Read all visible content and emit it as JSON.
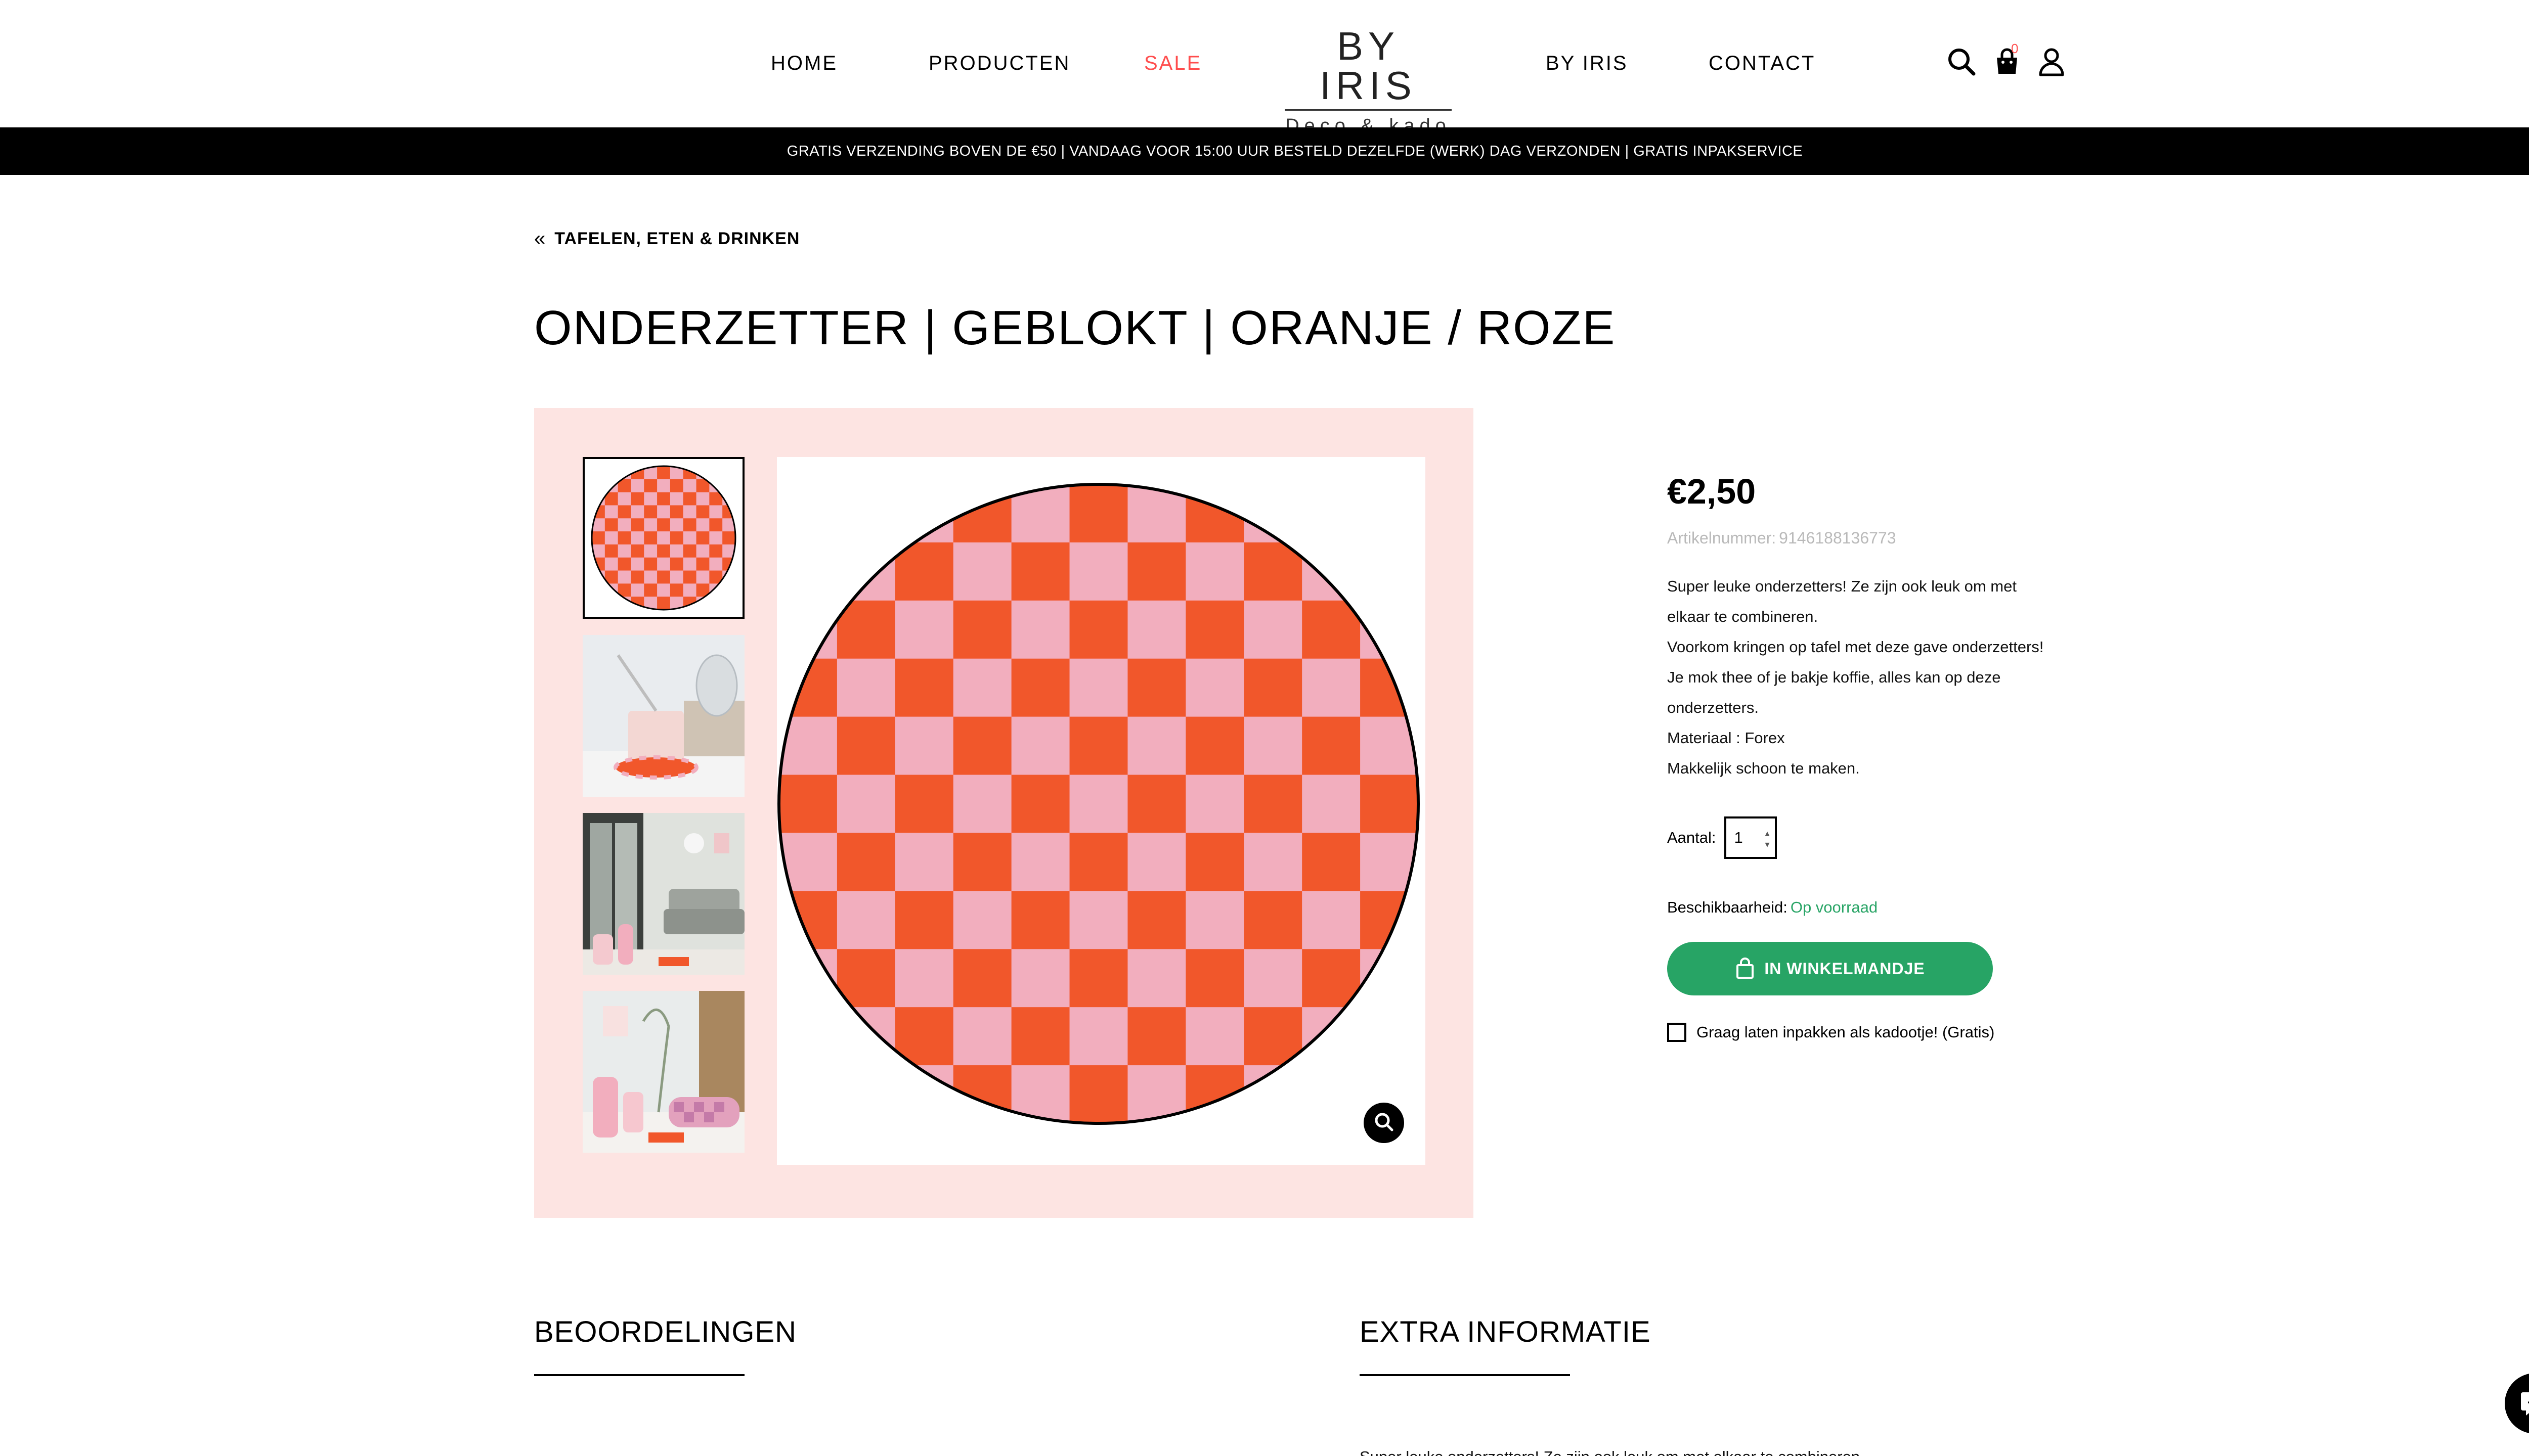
{
  "header": {
    "nav": {
      "home": "HOME",
      "products": "PRODUCTEN",
      "sale": "SALE",
      "about": "BY IRIS",
      "contact": "CONTACT"
    },
    "logo": {
      "title": "BY IRIS",
      "subtitle": "Deco & kado"
    },
    "icons": [
      "search-icon",
      "cart-icon",
      "user-icon"
    ],
    "cart_count": "0"
  },
  "announcement": "GRATIS VERZENDING BOVEN DE €50 | VANDAAG VOOR 15:00 UUR BESTELD DEZELFDE (WERK) DAG VERZONDEN | GRATIS INPAKSERVICE",
  "breadcrumb": {
    "icon": "double-chevron-left-icon",
    "label": "TAFELEN, ETEN & DRINKEN"
  },
  "product": {
    "title": "ONDERZETTER | GEBLOKT | ORANJE / ROZE",
    "price": "€2,50",
    "sku_label": "Artikelnummer:",
    "sku_value": "9146188136773",
    "description": [
      "Super leuke onderzetters! Ze zijn ook leuk om met",
      "elkaar te combineren.",
      "Voorkom kringen op tafel met deze gave onderzetters!",
      "Je mok thee of je bakje koffie, alles kan op deze",
      "onderzetters.",
      "Materiaal : Forex",
      "Makkelijk schoon te maken."
    ],
    "quantity_label": "Aantal:",
    "quantity_value": "1",
    "availability_label": "Beschikbaarheid:",
    "availability_value": "Op voorraad",
    "add_to_cart_label": "IN WINKELMANDJE",
    "gift_label": "Graag laten inpakken als kadootje! (Gratis)",
    "gift_checked": false
  },
  "gallery": {
    "thumbnails": [
      "checkered-coaster",
      "mug-on-coaster",
      "living-room-scene",
      "table-scene"
    ],
    "active_index": 0,
    "zoom_icon": "magnifier-icon"
  },
  "sections": {
    "reviews": "BEOORDELINGEN",
    "extra_info": "EXTRA INFORMATIE",
    "extra_info_preview": "Super leuke onderzetters! Ze zijn ook leuk om met elkaar te combineren."
  },
  "colors": {
    "accent_green": "#27a465",
    "sale_red": "#ff4d4d",
    "gallery_bg": "#fde4e2",
    "check_orange": "#f1572b",
    "check_pink": "#f2aebe"
  }
}
